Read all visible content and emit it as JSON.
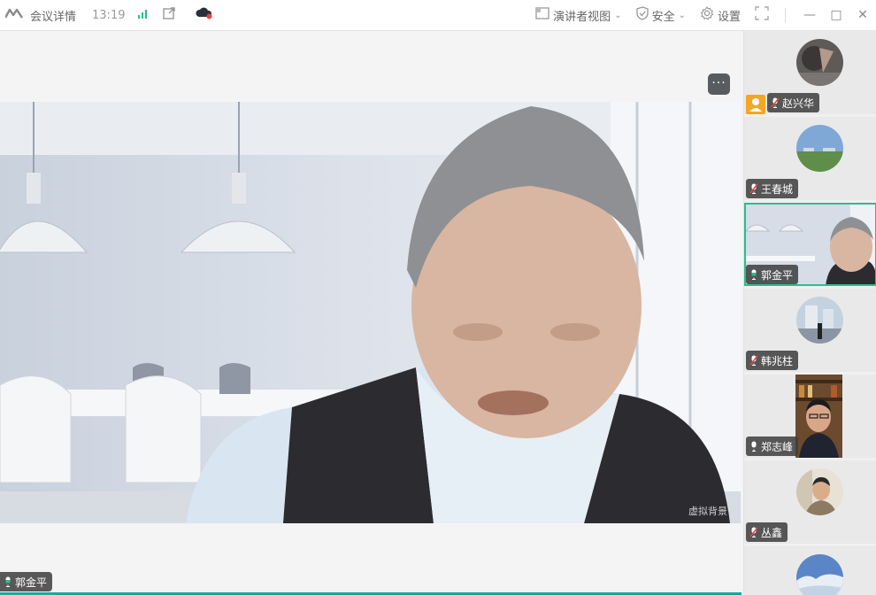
{
  "topbar": {
    "app_title": "会议详情",
    "time": "13:19",
    "view_label": "演讲者视图",
    "security_label": "安全",
    "settings_label": "设置"
  },
  "main": {
    "speaker_name": "郭金平",
    "watermark": "虚拟背景"
  },
  "participants": [
    {
      "name": "赵兴华",
      "mic": "off",
      "host": true
    },
    {
      "name": "王春城",
      "mic": "off"
    },
    {
      "name": "郭金平",
      "mic": "on",
      "active": true
    },
    {
      "name": "韩兆柱",
      "mic": "off"
    },
    {
      "name": "郑志峰",
      "mic": "on"
    },
    {
      "name": "丛鑫",
      "mic": "off"
    }
  ],
  "colors": {
    "accent": "#2bbd8c",
    "signal": "#2bbd8c",
    "host_badge": "#f5a623",
    "mic_off": "#e04a3d"
  }
}
